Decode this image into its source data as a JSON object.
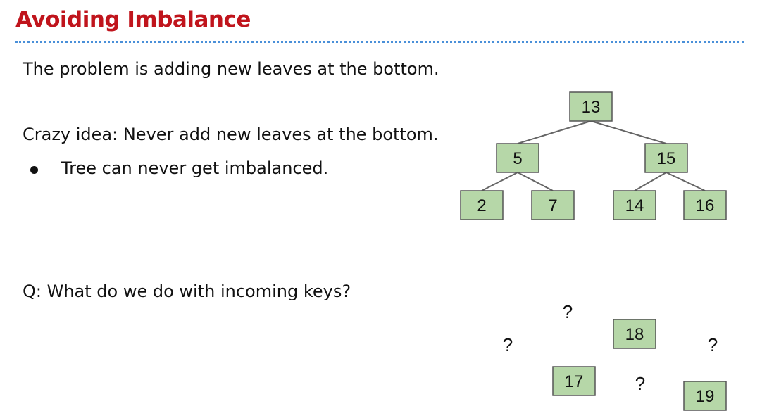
{
  "slide": {
    "title": "Avoiding Imbalance",
    "line1": "The problem is adding new leaves at the bottom.",
    "line2": "Crazy idea: Never add new leaves at the bottom.",
    "bullet1": "Tree can never get imbalanced.",
    "question": "Q: What do we do with incoming keys?"
  },
  "tree": {
    "root": "13",
    "left": "5",
    "right": "15",
    "left_left": "2",
    "left_right": "7",
    "right_left": "14",
    "right_right": "16"
  },
  "incoming": {
    "keys": [
      "18",
      "17",
      "19"
    ],
    "unknown_mark": "?"
  },
  "colors": {
    "title": "#c0141c",
    "node_fill": "#b6d7a8",
    "rule": "#4a90d9"
  }
}
